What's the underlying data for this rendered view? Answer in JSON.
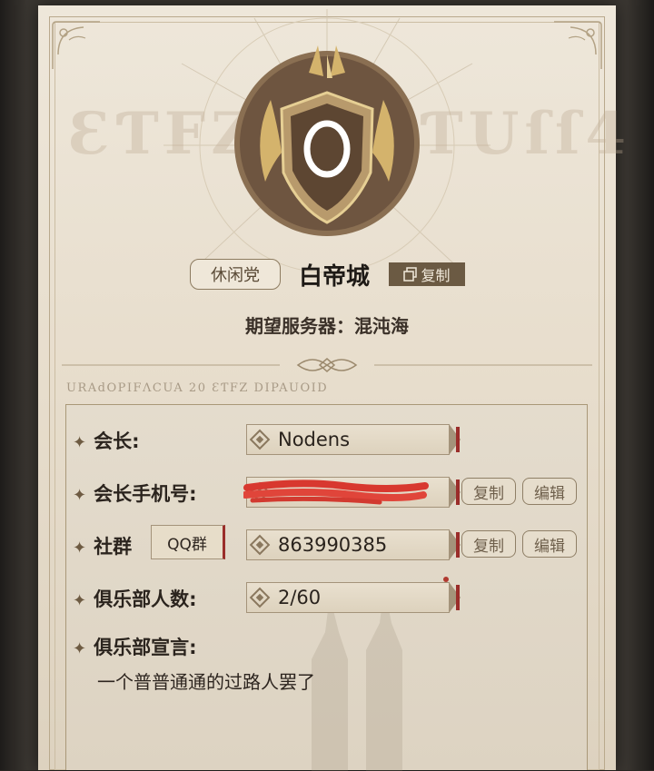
{
  "header": {
    "emblem_letter": "O",
    "tag": "休闲党",
    "club_name": "白帝城",
    "copy_label": "复制",
    "server_label": "期望服务器：",
    "server_value": "混沌海",
    "rune_left": "ƐƬFZ",
    "rune_right": "ƬUſſ4",
    "rune_subtitle": "URAdOPIFɅCUA 20 ƐƬFZ DIPAUOID"
  },
  "rows": {
    "leader": {
      "label": "会长:",
      "value": "Nodens"
    },
    "phone": {
      "label": "会长手机号:",
      "value": "",
      "copy_label": "复制",
      "edit_label": "编辑"
    },
    "community": {
      "label": "社群",
      "type_button": "QQ群",
      "value": "863990385",
      "copy_label": "复制",
      "edit_label": "编辑"
    },
    "members": {
      "label": "俱乐部人数:",
      "value": "2/60"
    },
    "declaration": {
      "label": "俱乐部宣言:",
      "text": "一个普普通通的过路人罢了"
    }
  },
  "colors": {
    "paper": "#eee7da",
    "accent_brown": "#6b5a43",
    "accent_red": "#9a2d2a",
    "text_dark": "#2b241e"
  },
  "icons": [
    "emblem-icon",
    "copy-icon",
    "star-icon",
    "diamond-icon"
  ]
}
